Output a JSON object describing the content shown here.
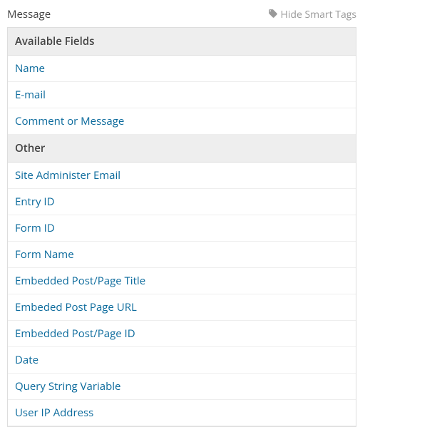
{
  "header": {
    "section_label": "Message",
    "toggle_label": "Hide Smart Tags"
  },
  "groups": [
    {
      "title": "Available Fields",
      "items": [
        "Name",
        "E-mail",
        "Comment or Message"
      ]
    },
    {
      "title": "Other",
      "items": [
        "Site Administer Email",
        "Entry ID",
        "Form ID",
        "Form Name",
        "Embedded Post/Page Title",
        "Embeded Post Page URL",
        "Embedded Post/Page ID",
        "Date",
        "Query String Variable",
        "User IP Address"
      ]
    }
  ]
}
